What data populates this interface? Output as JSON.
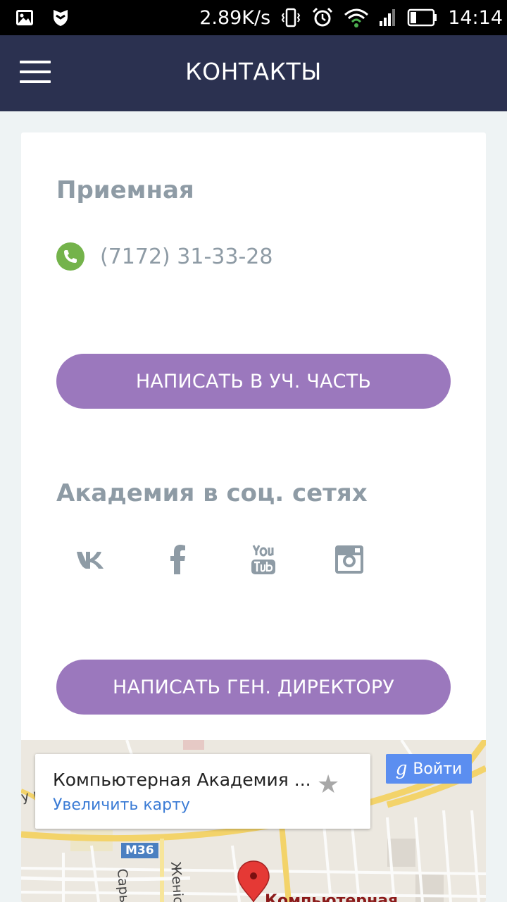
{
  "status_bar": {
    "network_speed": "2.89K/s",
    "time": "14:14"
  },
  "app_bar": {
    "title": "КОНТАКТЫ"
  },
  "reception": {
    "heading": "Приемная",
    "phone": "(7172) 31-33-28"
  },
  "buttons": {
    "write_academic": "НАПИСАТЬ В УЧ. ЧАСТЬ",
    "write_director": "НАПИСАТЬ ГЕН. ДИРЕКТОРУ"
  },
  "social": {
    "heading": "Академия в соц. сетях",
    "icons": [
      "vk-icon",
      "facebook-icon",
      "youtube-icon",
      "instagram-icon"
    ],
    "icon_color": "#8e9ba5"
  },
  "map": {
    "place_name": "Компьютерная Академия ...",
    "enlarge_link": "Увеличить карту",
    "signin_label": "Войти",
    "road_label": "M36",
    "street_1": "Сарь",
    "street_2": "Женіс",
    "street_3": "у к",
    "marker_label": "Компьютерная"
  },
  "colors": {
    "app_bar": "#2b3150",
    "button": "#9b78bd",
    "phone_icon": "#74b34b",
    "text_muted": "#8e9ba5"
  }
}
